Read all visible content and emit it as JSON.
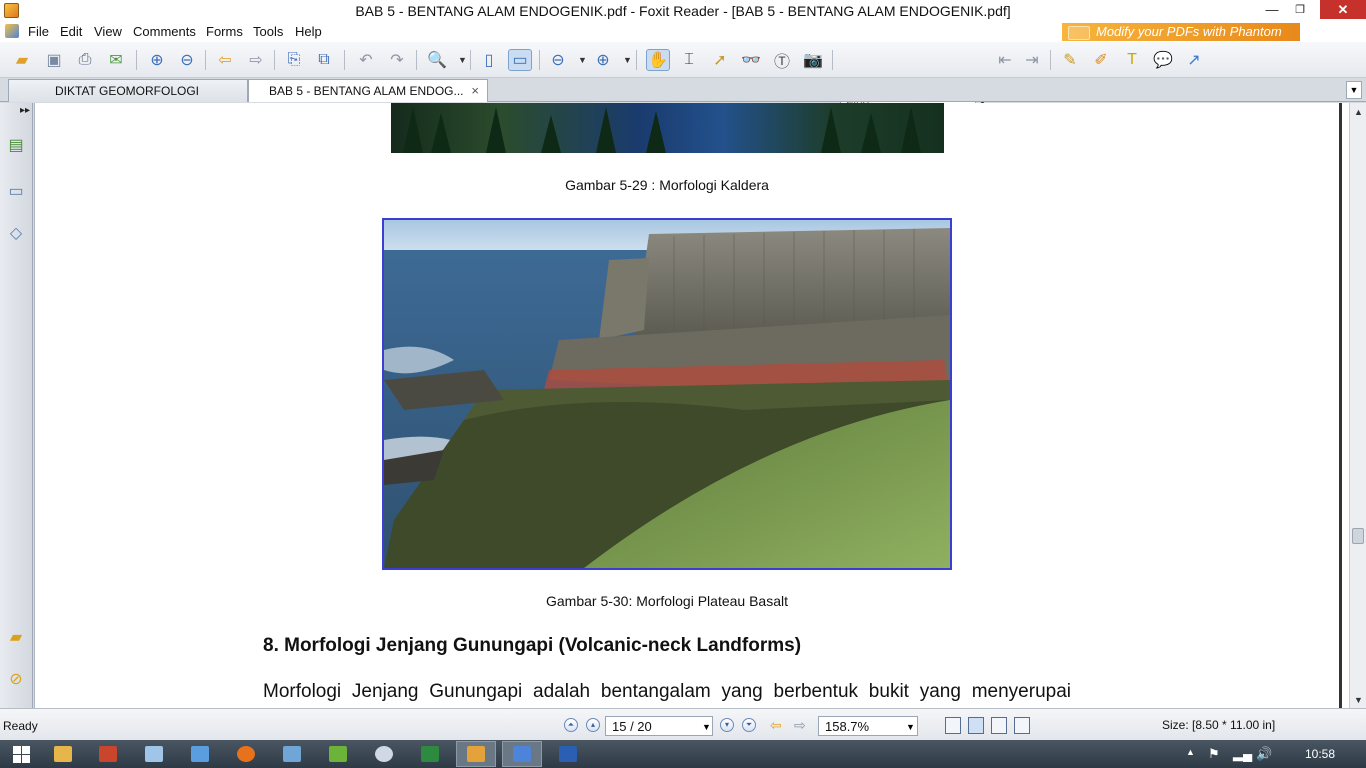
{
  "window": {
    "title": "BAB 5 - BENTANG ALAM ENDOGENIK.pdf - Foxit Reader - [BAB 5 - BENTANG ALAM ENDOGENIK.pdf]",
    "minimize_glyph": "—",
    "restore_glyph": "❐",
    "close_glyph": "✕"
  },
  "menu": {
    "items": [
      "File",
      "Edit",
      "View",
      "Comments",
      "Forms",
      "Tools",
      "Help"
    ],
    "banner": "Modify your PDFs with Phantom"
  },
  "toolbar": {
    "find_placeholder": "Find",
    "icons": [
      "open-icon",
      "save-icon",
      "print-icon",
      "email-icon",
      "page-up-icon",
      "page-down-icon",
      "back-icon",
      "forward-icon",
      "extract-icon",
      "insert-icon",
      "undo-icon",
      "redo-icon",
      "zoom-in-icon",
      "fit-page-icon",
      "fit-width-icon",
      "zoom-out-icon",
      "zoom-plus-icon",
      "hand-icon",
      "select-text-icon",
      "select-icon",
      "find-icon",
      "typewriter-icon",
      "snapshot-icon",
      "find-prev-icon",
      "find-next-icon",
      "sign-icon",
      "highlight-icon",
      "text-box-icon",
      "note-icon",
      "arrow-icon"
    ]
  },
  "tabs": [
    {
      "label": "DIKTAT GEOMORFOLOGI"
    },
    {
      "label": "BAB 5 - BENTANG ALAM ENDOG...",
      "close": "×"
    }
  ],
  "document": {
    "caption1": "Gambar 5-29 : Morfologi Kaldera",
    "caption2": "Gambar 5-30:  Morfologi Plateau Basalt",
    "heading": "8.  Morfologi Jenjang Gunungapi (Volcanic-neck Landforms)",
    "paragraph": "Morfologi Jenjang Gunungapi adalah bentangalam yang berbentuk bukit yang menyerupai"
  },
  "status": {
    "text": "Ready",
    "page": "15 / 20",
    "zoom": "158.7%",
    "size": "Size: [8.50 * 11.00 in]"
  },
  "taskbar": {
    "clock": "10:58"
  }
}
